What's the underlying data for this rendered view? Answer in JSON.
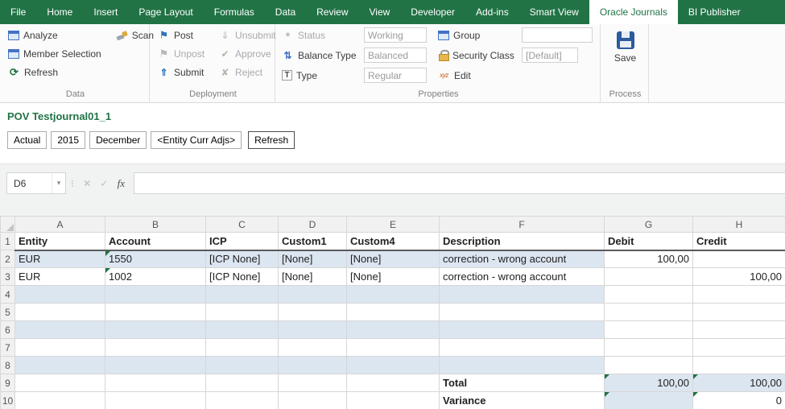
{
  "tabs": [
    {
      "label": "File"
    },
    {
      "label": "Home"
    },
    {
      "label": "Insert"
    },
    {
      "label": "Page Layout"
    },
    {
      "label": "Formulas"
    },
    {
      "label": "Data"
    },
    {
      "label": "Review"
    },
    {
      "label": "View"
    },
    {
      "label": "Developer"
    },
    {
      "label": "Add-ins"
    },
    {
      "label": "Smart View"
    },
    {
      "label": "Oracle Journals"
    },
    {
      "label": "BI Publisher"
    }
  ],
  "active_tab": "Oracle Journals",
  "ribbon": {
    "data": {
      "label": "Data",
      "analyze": "Analyze",
      "member_selection": "Member Selection",
      "refresh": "Refresh",
      "scan": "Scan"
    },
    "deployment": {
      "label": "Deployment",
      "post": "Post",
      "unpost": "Unpost",
      "submit": "Submit",
      "unsubmit": "Unsubmit",
      "approve": "Approve",
      "reject": "Reject"
    },
    "properties": {
      "label": "Properties",
      "status": "Status",
      "status_value": "Working",
      "balance_type": "Balance Type",
      "balance_type_value": "Balanced",
      "type": "Type",
      "type_value": "Regular",
      "group": "Group",
      "group_value": "",
      "security_class": "Security Class",
      "security_class_value": "[Default]",
      "edit": "Edit"
    },
    "process": {
      "label": "Process",
      "save": "Save"
    }
  },
  "pov": {
    "title": "POV Testjournal01_1",
    "members": [
      "Actual",
      "2015",
      "December",
      "<Entity Curr Adjs>"
    ],
    "refresh": "Refresh"
  },
  "formula_bar": {
    "name_box": "D6",
    "icons": {
      "dropdown": "▾",
      "dots": "⁝",
      "cancel": "✕",
      "enter": "✓",
      "fx": "fx"
    },
    "formula": ""
  },
  "colors": {
    "excel_green": "#217346",
    "row_fill": "#DCE6F1",
    "marker_green": "#1E7145"
  },
  "grid": {
    "column_headers": [
      "A",
      "B",
      "C",
      "D",
      "E",
      "F",
      "G",
      "H"
    ],
    "rows": [
      {
        "n": "1",
        "header": true,
        "cells": [
          {
            "text": "Entity",
            "bold": true
          },
          {
            "text": "Account",
            "bold": true
          },
          {
            "text": "ICP",
            "bold": true
          },
          {
            "text": "Custom1",
            "bold": true
          },
          {
            "text": "Custom4",
            "bold": true
          },
          {
            "text": "Description",
            "bold": true
          },
          {
            "text": "Debit",
            "bold": true
          },
          {
            "text": "Credit",
            "bold": true
          }
        ]
      },
      {
        "n": "2",
        "cells": [
          {
            "text": "EUR",
            "fill": true
          },
          {
            "text": "1550",
            "fill": true,
            "marker": true
          },
          {
            "text": "[ICP None]",
            "fill": true
          },
          {
            "text": "[None]",
            "fill": true
          },
          {
            "text": "[None]",
            "fill": true
          },
          {
            "text": "correction - wrong account",
            "fill": true
          },
          {
            "text": "100,00",
            "right": true
          },
          {
            "text": ""
          }
        ]
      },
      {
        "n": "3",
        "cells": [
          {
            "text": "EUR"
          },
          {
            "text": "1002",
            "marker": true
          },
          {
            "text": "[ICP None]"
          },
          {
            "text": "[None]"
          },
          {
            "text": "[None]"
          },
          {
            "text": "correction - wrong account"
          },
          {
            "text": ""
          },
          {
            "text": "100,00",
            "right": true
          }
        ]
      },
      {
        "n": "4",
        "cells": [
          {
            "fill": true
          },
          {
            "fill": true
          },
          {
            "fill": true
          },
          {
            "fill": true
          },
          {
            "fill": true
          },
          {
            "fill": true
          },
          {},
          {}
        ]
      },
      {
        "n": "5",
        "cells": [
          {},
          {},
          {},
          {},
          {},
          {},
          {},
          {}
        ]
      },
      {
        "n": "6",
        "cells": [
          {
            "fill": true
          },
          {
            "fill": true
          },
          {
            "fill": true
          },
          {
            "fill": true
          },
          {
            "fill": true
          },
          {
            "fill": true
          },
          {},
          {}
        ]
      },
      {
        "n": "7",
        "cells": [
          {},
          {},
          {},
          {},
          {},
          {},
          {},
          {}
        ]
      },
      {
        "n": "8",
        "cells": [
          {
            "fill": true
          },
          {
            "fill": true
          },
          {
            "fill": true
          },
          {
            "fill": true
          },
          {
            "fill": true
          },
          {
            "fill": true
          },
          {},
          {}
        ]
      },
      {
        "n": "9",
        "cells": [
          {},
          {},
          {},
          {},
          {},
          {
            "text": "Total",
            "bold": true
          },
          {
            "text": "100,00",
            "right": true,
            "fill": true,
            "marker": true
          },
          {
            "text": "100,00",
            "right": true,
            "fill": true,
            "marker": true
          }
        ]
      },
      {
        "n": "10",
        "cells": [
          {},
          {},
          {},
          {},
          {},
          {
            "text": "Variance",
            "bold": true
          },
          {
            "fill": true,
            "marker": true
          },
          {
            "text": "0",
            "right": true,
            "marker": true
          }
        ]
      }
    ]
  }
}
